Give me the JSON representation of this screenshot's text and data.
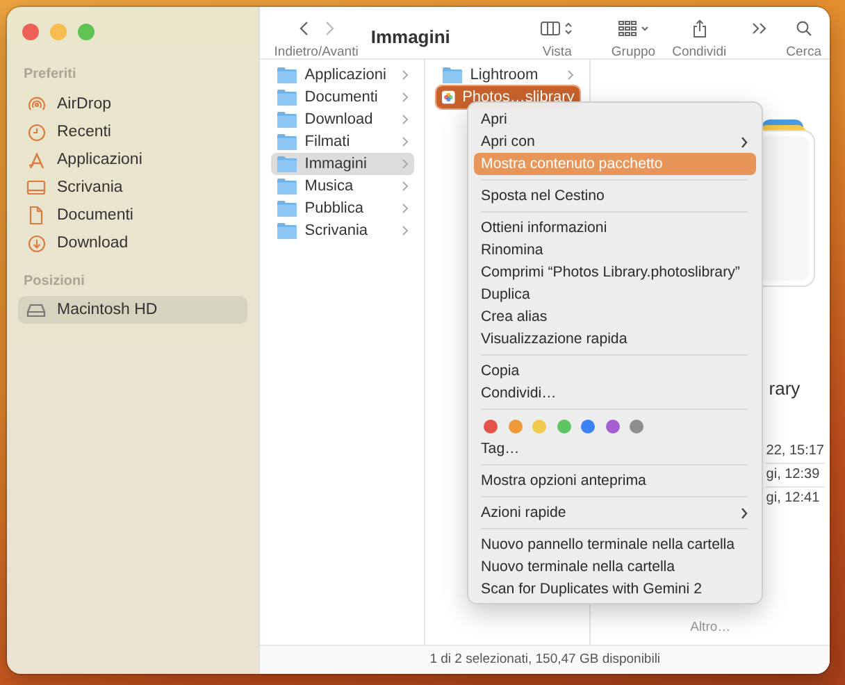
{
  "window": {
    "title": "Immagini"
  },
  "toolbar": {
    "nav_label": "Indietro/Avanti",
    "buttons": [
      {
        "kind": "view",
        "label": "Vista"
      },
      {
        "kind": "group",
        "label": "Gruppo"
      },
      {
        "kind": "share",
        "label": "Condividi"
      },
      {
        "kind": "more"
      },
      {
        "kind": "search",
        "label": "Cerca"
      }
    ]
  },
  "sidebar": {
    "sections": [
      {
        "heading": "Preferiti",
        "items": [
          {
            "kind": "airdrop",
            "label": "AirDrop",
            "selected": false
          },
          {
            "kind": "recent",
            "label": "Recenti",
            "selected": false
          },
          {
            "kind": "apps",
            "label": "Applicazioni",
            "selected": false
          },
          {
            "kind": "desktop",
            "label": "Scrivania",
            "selected": false
          },
          {
            "kind": "document",
            "label": "Documenti",
            "selected": false
          },
          {
            "kind": "download",
            "label": "Download",
            "selected": false
          }
        ]
      },
      {
        "heading": "Posizioni",
        "items": [
          {
            "kind": "disk",
            "label": "Macintosh HD",
            "selected": true
          }
        ]
      }
    ]
  },
  "columns": [
    {
      "active": false,
      "items": [
        {
          "kind": "folder",
          "name": "Applicazioni",
          "selected": false
        },
        {
          "kind": "folder",
          "name": "Documenti",
          "selected": false
        },
        {
          "kind": "folder",
          "name": "Download",
          "selected": false
        },
        {
          "kind": "folder",
          "name": "Filmati",
          "selected": false
        },
        {
          "kind": "folder",
          "name": "Immagini",
          "selected": true
        },
        {
          "kind": "folder",
          "name": "Musica",
          "selected": false
        },
        {
          "kind": "folder",
          "name": "Pubblica",
          "selected": false
        },
        {
          "kind": "folder",
          "name": "Scrivania",
          "selected": false
        }
      ]
    },
    {
      "active": true,
      "items": [
        {
          "kind": "folder",
          "name": "Lightroom",
          "selected": false
        },
        {
          "kind": "package",
          "name": "Photos…slibrary",
          "selected": true
        }
      ]
    }
  ],
  "preview": {
    "title": "rary",
    "rows": [
      "22, 15:17",
      "gi, 12:39",
      "gi, 12:41"
    ],
    "more": "Altro…"
  },
  "context_menu": {
    "items": [
      {
        "kind": "item",
        "label": "Apri",
        "submenu": false,
        "selected": false
      },
      {
        "kind": "item",
        "label": "Apri con",
        "submenu": true,
        "selected": false
      },
      {
        "kind": "item",
        "label": "Mostra contenuto pacchetto",
        "submenu": false,
        "selected": true
      },
      {
        "kind": "separator"
      },
      {
        "kind": "item",
        "label": "Sposta nel Cestino",
        "submenu": false,
        "selected": false
      },
      {
        "kind": "separator"
      },
      {
        "kind": "item",
        "label": "Ottieni informazioni",
        "submenu": false,
        "selected": false
      },
      {
        "kind": "item",
        "label": "Rinomina",
        "submenu": false,
        "selected": false
      },
      {
        "kind": "item",
        "label": "Comprimi “Photos Library.photoslibrary”",
        "submenu": false,
        "selected": false
      },
      {
        "kind": "item",
        "label": "Duplica",
        "submenu": false,
        "selected": false
      },
      {
        "kind": "item",
        "label": "Crea alias",
        "submenu": false,
        "selected": false
      },
      {
        "kind": "item",
        "label": "Visualizzazione rapida",
        "submenu": false,
        "selected": false
      },
      {
        "kind": "separator"
      },
      {
        "kind": "item",
        "label": "Copia",
        "submenu": false,
        "selected": false
      },
      {
        "kind": "item",
        "label": "Condividi…",
        "submenu": false,
        "selected": false
      },
      {
        "kind": "separator"
      },
      {
        "kind": "tags",
        "tags": [
          {
            "color": "#e5534b"
          },
          {
            "color": "#ee9a3a"
          },
          {
            "color": "#f2c94c"
          },
          {
            "color": "#5dc563"
          },
          {
            "color": "#3b82f6"
          },
          {
            "color": "#a55fd3"
          },
          {
            "color": "#8e8e93"
          }
        ]
      },
      {
        "kind": "item",
        "label": "Tag…",
        "submenu": false,
        "selected": false
      },
      {
        "kind": "separator"
      },
      {
        "kind": "item",
        "label": "Mostra opzioni anteprima",
        "submenu": false,
        "selected": false
      },
      {
        "kind": "separator"
      },
      {
        "kind": "item",
        "label": "Azioni rapide",
        "submenu": true,
        "selected": false
      },
      {
        "kind": "separator"
      },
      {
        "kind": "item",
        "label": "Nuovo pannello terminale nella cartella",
        "submenu": false,
        "selected": false
      },
      {
        "kind": "item",
        "label": "Nuovo terminale nella cartella",
        "submenu": false,
        "selected": false
      },
      {
        "kind": "item",
        "label": "Scan for Duplicates with Gemini 2",
        "submenu": false,
        "selected": false
      }
    ]
  },
  "status_bar": "1 di 2 selezionati, 150,47 GB disponibili"
}
